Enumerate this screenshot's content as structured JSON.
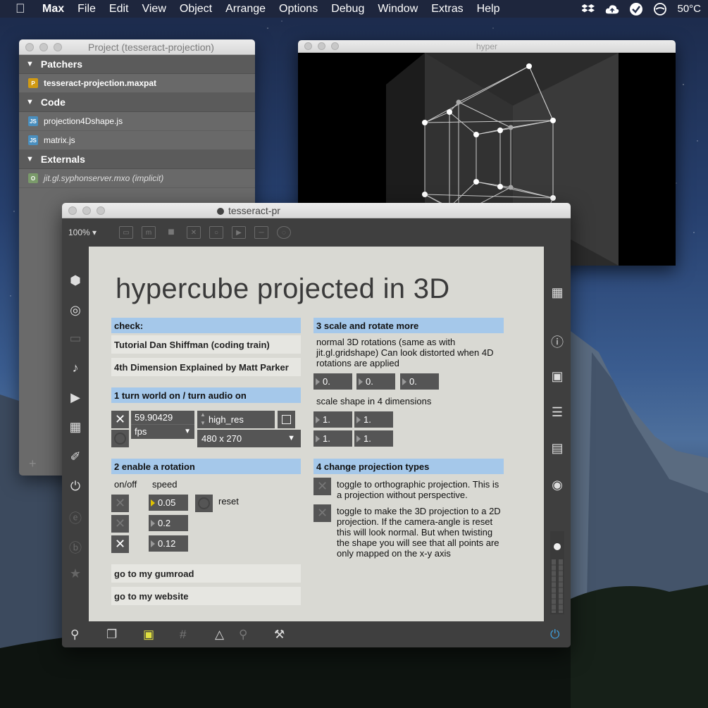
{
  "menubar": {
    "items": [
      "Max",
      "File",
      "Edit",
      "View",
      "Object",
      "Arrange",
      "Options",
      "Debug",
      "Window",
      "Extras",
      "Help"
    ],
    "temperature": "50°C",
    "status_icons": [
      "dropbox-icon",
      "cloud-upload-icon",
      "check-circle-icon",
      "do-not-disturb-icon"
    ]
  },
  "project": {
    "title": "Project (tesseract-projection)",
    "sections": [
      {
        "label": "Patchers",
        "items": [
          {
            "badge": "P",
            "badge_color": "#d19a12",
            "name": "tesseract-projection.maxpat"
          }
        ]
      },
      {
        "label": "Code",
        "items": [
          {
            "badge": "JS",
            "badge_color": "#4a8fbf",
            "name": "projection4Dshape.js"
          },
          {
            "badge": "JS",
            "badge_color": "#4a8fbf",
            "name": "matrix.js"
          }
        ]
      },
      {
        "label": "Externals",
        "items": [
          {
            "badge": "O",
            "badge_color": "#7a9a6a",
            "name": "jit.gl.syphonserver.mxo (implicit)"
          }
        ]
      }
    ]
  },
  "hyper": {
    "title": "hyper"
  },
  "patcher": {
    "title": "tesseract-pr",
    "zoom": "100%",
    "main_title": "hypercube projected in 3D",
    "check_header": "check:",
    "check_items": [
      "Tutorial Dan Shiffman (coding train)",
      "4th Dimension Explained by Matt Parker"
    ],
    "section1": {
      "header": "1 turn world on / turn audio on",
      "fps_value": "59.90429",
      "fps_unit": "fps",
      "quality": "high_res",
      "resolution": "480 x 270"
    },
    "section2": {
      "header": "2 enable a rotation",
      "col_onoff": "on/off",
      "col_speed": "speed",
      "speeds": [
        "0.05",
        "0.2",
        "0.12"
      ],
      "toggles": [
        false,
        false,
        true
      ],
      "reset_label": "reset"
    },
    "links": [
      "go to my gumroad",
      "go to my website"
    ],
    "section3": {
      "header": "3 scale and rotate more",
      "description": "normal 3D rotations (same as with jit.gl.gridshape) Can look distorted when 4D rotations are applied",
      "rotations": [
        "0.",
        "0.",
        "0."
      ],
      "scale_label": "scale shape in 4 dimensions",
      "scales": [
        "1.",
        "1.",
        "1.",
        "1."
      ]
    },
    "section4": {
      "header": "4 change projection types",
      "ortho_text": "toggle to orthographic projection. This is a projection without perspective.",
      "twod_text": "toggle to make the 3D projection to a 2D projection. If the camera-angle is reset this will look normal. But when twisting the shape you will see that all points are only mapped on the x-y axis"
    }
  }
}
